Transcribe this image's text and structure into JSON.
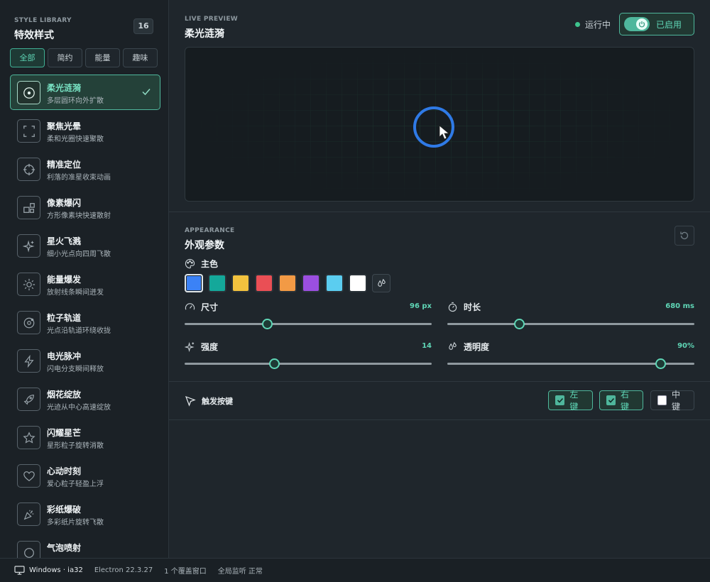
{
  "sidebar": {
    "caption": "STYLE LIBRARY",
    "title": "特效样式",
    "count": "16",
    "filters": [
      "全部",
      "简约",
      "能量",
      "趣味"
    ],
    "active_filter": "全部",
    "items": [
      {
        "name": "柔光涟漪",
        "desc": "多层圆环向外扩散",
        "icon": "ripple-icon",
        "selected": true
      },
      {
        "name": "聚焦光晕",
        "desc": "柔和光圈快速聚散",
        "icon": "focus-frame-icon"
      },
      {
        "name": "精准定位",
        "desc": "利落的准星收束动画",
        "icon": "crosshair-icon"
      },
      {
        "name": "像素爆闪",
        "desc": "方形像素块快速散射",
        "icon": "pixel-blocks-icon"
      },
      {
        "name": "星火飞溅",
        "desc": "细小光点向四周飞散",
        "icon": "sparkles-icon"
      },
      {
        "name": "能量爆发",
        "desc": "放射线条瞬间迸发",
        "icon": "sun-burst-icon"
      },
      {
        "name": "粒子轨道",
        "desc": "光点沿轨道环绕收拢",
        "icon": "orbit-icon"
      },
      {
        "name": "电光脉冲",
        "desc": "闪电分支瞬间释放",
        "icon": "lightning-icon"
      },
      {
        "name": "烟花绽放",
        "desc": "光迹从中心高速绽放",
        "icon": "rocket-icon"
      },
      {
        "name": "闪耀星芒",
        "desc": "星形粒子旋转消散",
        "icon": "star-icon"
      },
      {
        "name": "心动时刻",
        "desc": "爱心粒子轻盈上浮",
        "icon": "heart-icon"
      },
      {
        "name": "彩纸爆破",
        "desc": "多彩纸片旋转飞散",
        "icon": "party-popper-icon"
      },
      {
        "name": "气泡喷射",
        "desc": "",
        "icon": "bubble-icon"
      }
    ]
  },
  "preview": {
    "caption": "LIVE PREVIEW",
    "title": "柔光涟漪",
    "running_label": "运行中",
    "enable_label": "已启用"
  },
  "appearance": {
    "caption": "APPEARANCE",
    "title": "外观参数",
    "color_label": "主色",
    "colors": [
      "#3b82f6",
      "#14a89a",
      "#f2c23e",
      "#ea4f55",
      "#f29a45",
      "#9b4fe0",
      "#5bcdf0",
      "#ffffff"
    ],
    "selected_color": "#3b82f6",
    "sliders": [
      {
        "key": "size",
        "label": "尺寸",
        "value": "96 px",
        "fraction": 0.333,
        "icon": "gauge-icon"
      },
      {
        "key": "duration",
        "label": "时长",
        "value": "680 ms",
        "fraction": 0.291,
        "icon": "stopwatch-icon"
      },
      {
        "key": "intensity",
        "label": "强度",
        "value": "14",
        "fraction": 0.361,
        "icon": "sparkle-icon"
      },
      {
        "key": "opacity",
        "label": "透明度",
        "value": "90%",
        "fraction": 0.861,
        "icon": "droplets-icon"
      }
    ]
  },
  "trigger": {
    "label": "触发按键",
    "buttons": [
      {
        "label": "左键",
        "checked": true
      },
      {
        "label": "右键",
        "checked": true
      },
      {
        "label": "中键",
        "checked": false
      }
    ]
  },
  "status": {
    "host": "Windows · ia32",
    "electron": "Electron 22.3.27",
    "windows": "1 个覆盖窗口",
    "hook": "全局监听 正常"
  },
  "colors": {
    "accent": "#4fb79c",
    "accent_text": "#5fd6b6",
    "ripple": "#2f7ae6",
    "status_dot": "#3ec48e"
  }
}
